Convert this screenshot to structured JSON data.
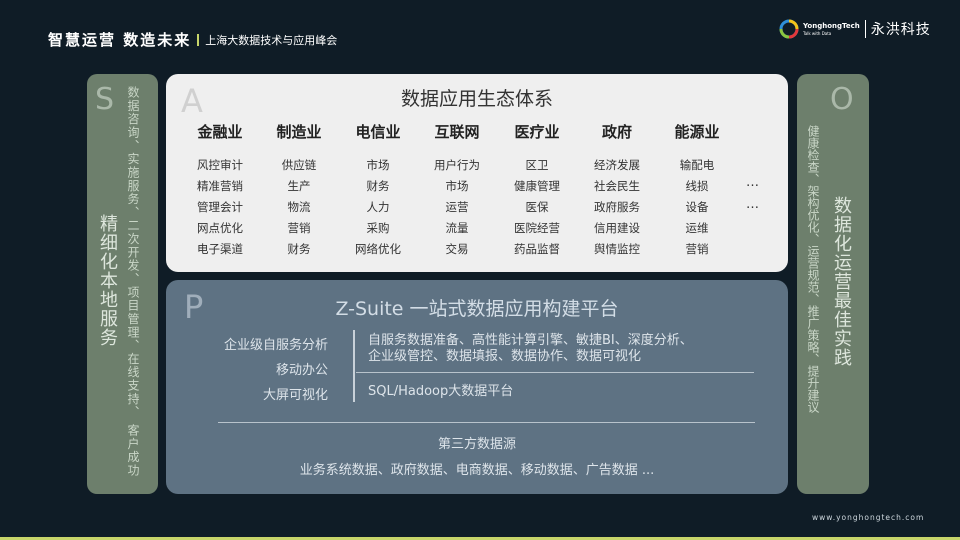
{
  "header": {
    "slogan": "智慧运营 数造未来",
    "subtitle": "上海大数据技术与应用峰会"
  },
  "logo": {
    "name_en": "YonghongTech",
    "tagline": "Talk with Data",
    "name_cn": "永洪科技"
  },
  "left_panel": {
    "letter": "S",
    "services": "数据咨询、实施服务、二次开发、项目管理、在线支持、 客户成功",
    "title": "精细化本地服务"
  },
  "right_panel": {
    "letter": "O",
    "title": "数据化运营最佳实践",
    "services": "健康检查、架构优化、运营规范、推广策略、提升建议"
  },
  "ecosystem": {
    "letter": "A",
    "title": "数据应用生态体系",
    "industries": [
      {
        "name": "金融业",
        "items": [
          "风控审计",
          "精准营销",
          "管理会计",
          "网点优化",
          "电子渠道"
        ]
      },
      {
        "name": "制造业",
        "items": [
          "供应链",
          "生产",
          "物流",
          "营销",
          "财务"
        ]
      },
      {
        "name": "电信业",
        "items": [
          "市场",
          "财务",
          "人力",
          "采购",
          "网络优化"
        ]
      },
      {
        "name": "互联网",
        "items": [
          "用户行为",
          "市场",
          "运营",
          "流量",
          "交易"
        ]
      },
      {
        "name": "医疗业",
        "items": [
          "区卫",
          "健康管理",
          "医保",
          "医院经营",
          "药品监督"
        ]
      },
      {
        "name": "政府",
        "items": [
          "经济发展",
          "社会民生",
          "政府服务",
          "信用建设",
          "舆情监控"
        ]
      },
      {
        "name": "能源业",
        "items": [
          "输配电",
          "线损",
          "设备",
          "运维",
          "营销"
        ]
      }
    ],
    "ellipsis": [
      "…",
      "…"
    ]
  },
  "platform": {
    "letter": "P",
    "title": "Z-Suite 一站式数据应用构建平台",
    "capabilities": [
      "企业级自服务分析",
      "移动办公",
      "大屏可视化"
    ],
    "features_line1": "自服务数据准备、高性能计算引擎、敏捷BI、深度分析、",
    "features_line2": "企业级管控、数据填报、数据协作、数据可视化",
    "base": "SQL/Hadoop大数据平台",
    "third_party_title": "第三方数据源",
    "third_party_list": "业务系统数据、政府数据、电商数据、移动数据、广告数据 ..."
  },
  "footer": {
    "website": "www.yonghongtech.com"
  },
  "colors": {
    "background": "#0f1c26",
    "side_panel": "#6d7f6c",
    "ecosystem_panel": "#efefef",
    "platform_panel": "#5e7283",
    "accent": "#c7d56a"
  }
}
